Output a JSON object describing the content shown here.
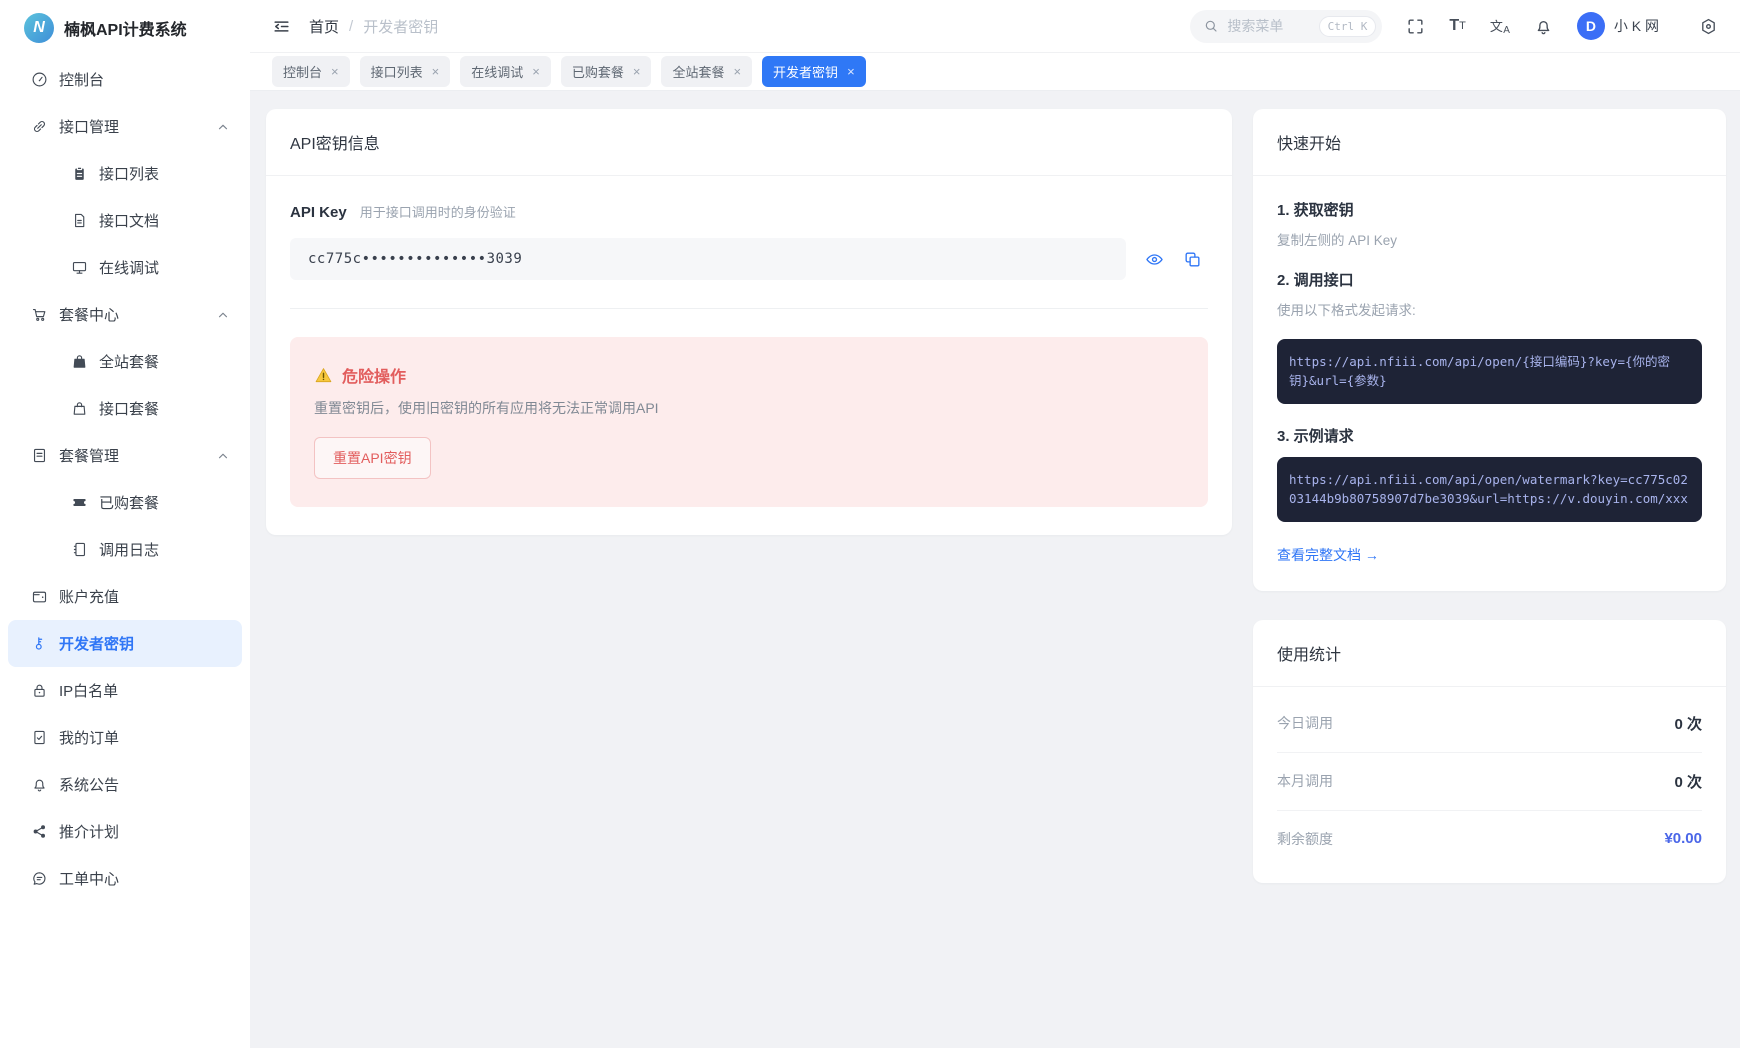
{
  "app": {
    "title": "楠枫API计费系统",
    "logo_letter": "N"
  },
  "colors": {
    "accent_blue": "#2f76f6",
    "active_bg": "#e8f1fe",
    "danger_red": "#e25d5d",
    "danger_bg": "#fdecec",
    "code_bg": "#1e2336",
    "code_text": "#a8b3ec",
    "balance_blue": "#4a66e8",
    "avatar_bg": "#3b6ef6"
  },
  "sidebar": {
    "items": [
      {
        "label": "控制台",
        "icon": "dashboard-icon"
      },
      {
        "label": "接口管理",
        "icon": "api-group-icon",
        "expanded": true
      },
      {
        "label": "接口列表",
        "icon": "clipboard-icon"
      },
      {
        "label": "接口文档",
        "icon": "document-icon"
      },
      {
        "label": "在线调试",
        "icon": "monitor-icon"
      },
      {
        "label": "套餐中心",
        "icon": "cart-icon",
        "expanded": true
      },
      {
        "label": "全站套餐",
        "icon": "bag-filled-icon"
      },
      {
        "label": "接口套餐",
        "icon": "bag-icon"
      },
      {
        "label": "套餐管理",
        "icon": "page-lines-icon",
        "expanded": true
      },
      {
        "label": "已购套餐",
        "icon": "ticket-icon"
      },
      {
        "label": "调用日志",
        "icon": "notebook-icon"
      },
      {
        "label": "账户充值",
        "icon": "wallet-icon"
      },
      {
        "label": "开发者密钥",
        "icon": "key-icon",
        "active": true
      },
      {
        "label": "IP白名单",
        "icon": "lock-icon"
      },
      {
        "label": "我的订单",
        "icon": "order-check-icon"
      },
      {
        "label": "系统公告",
        "icon": "bell-icon"
      },
      {
        "label": "推介计划",
        "icon": "share-icon"
      },
      {
        "label": "工单中心",
        "icon": "chat-icon"
      }
    ]
  },
  "header": {
    "breadcrumb": {
      "root": "首页",
      "separator": "/",
      "current": "开发者密钥"
    },
    "search": {
      "placeholder": "搜索菜单",
      "shortcut": "Ctrl K"
    },
    "tools": {
      "font_primary": "T",
      "font_secondary": "T",
      "translate_primary": "文",
      "translate_secondary": "A"
    },
    "user": {
      "name": "小 K 网",
      "avatar_letter": "D"
    }
  },
  "tabs": {
    "close_glyph": "×",
    "items": [
      {
        "label": "控制台"
      },
      {
        "label": "接口列表"
      },
      {
        "label": "在线调试"
      },
      {
        "label": "已购套餐"
      },
      {
        "label": "全站套餐"
      },
      {
        "label": "开发者密钥",
        "active": true
      }
    ]
  },
  "api_card": {
    "title": "API密钥信息",
    "key_label": "API Key",
    "key_hint": "用于接口调用时的身份验证",
    "key_masked": "cc775c••••••••••••••3039",
    "danger": {
      "title": "危险操作",
      "description": "重置密钥后，使用旧密钥的所有应用将无法正常调用API",
      "reset_button": "重置API密钥"
    }
  },
  "quick_start": {
    "title": "快速开始",
    "step1": {
      "heading": "1. 获取密钥",
      "text": "复制左侧的 API Key"
    },
    "step2": {
      "heading": "2. 调用接口",
      "text": "使用以下格式发起请求:",
      "code": "https://api.nfiii.com/api/open/{接口编码}?key={你的密钥}&url={参数}"
    },
    "step3": {
      "heading": "3. 示例请求",
      "code": "https://api.nfiii.com/api/open/watermark?key=cc775c0203144b9b80758907d7be3039&url=https://v.douyin.com/xxx"
    },
    "doc_link": "查看完整文档 →"
  },
  "usage_stats": {
    "title": "使用统计",
    "rows": [
      {
        "label": "今日调用",
        "value": "0 次"
      },
      {
        "label": "本月调用",
        "value": "0 次"
      },
      {
        "label": "剩余额度",
        "value": "¥0.00"
      }
    ]
  }
}
